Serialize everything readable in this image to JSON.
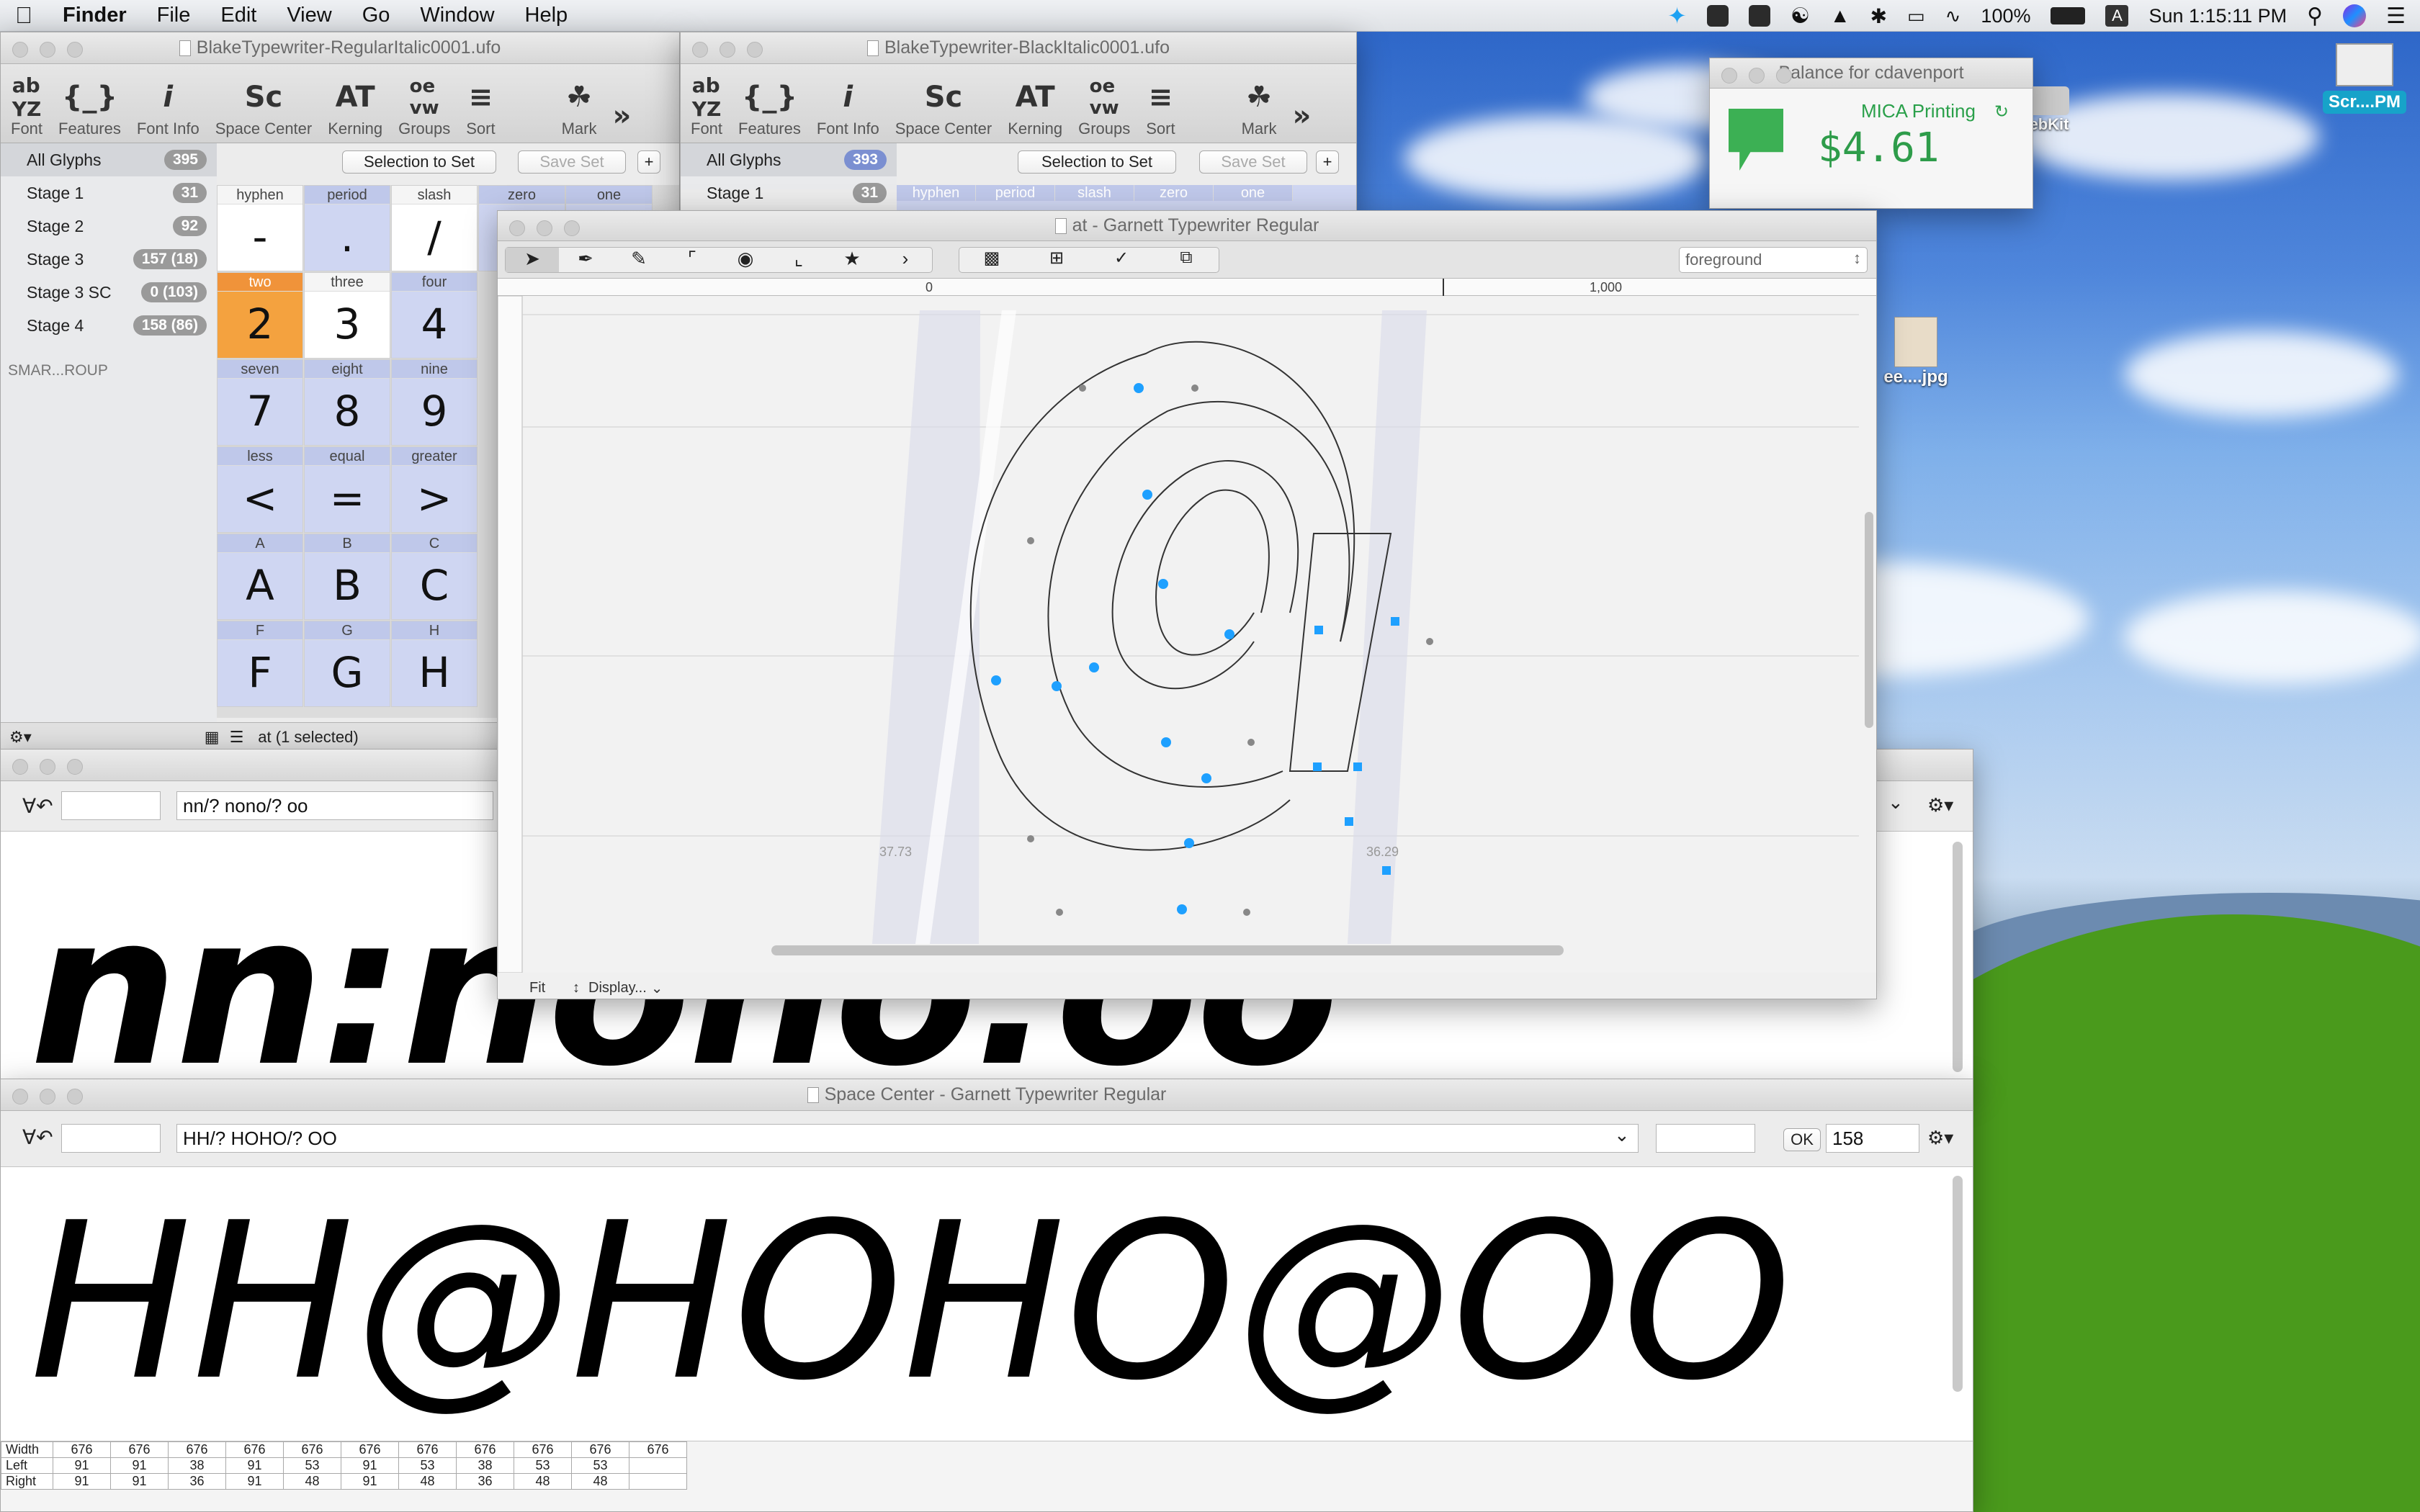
{
  "menubar": {
    "app": "Finder",
    "items": [
      "File",
      "Edit",
      "View",
      "Go",
      "Window",
      "Help"
    ],
    "battery": "100%",
    "clock": "Sun 1:15:11 PM"
  },
  "font_window_1": {
    "title": "BlakeTypewriter-RegularItalic0001.ufo",
    "toolbar": [
      "Font",
      "Features",
      "Font Info",
      "Space Center",
      "Kerning",
      "Groups",
      "Sort",
      "Mark"
    ],
    "sidebar": [
      {
        "label": "All Glyphs",
        "count": "395"
      },
      {
        "label": "Stage 1",
        "count": "31"
      },
      {
        "label": "Stage 2",
        "count": "92"
      },
      {
        "label": "Stage 3",
        "count": "157 (18)"
      },
      {
        "label": "Stage 3 SC",
        "count": "0 (103)"
      },
      {
        "label": "Stage 4",
        "count": "158 (86)"
      }
    ],
    "smart_group": "SMAR...ROUP",
    "selection_to_set": "Selection to Set",
    "save_set": "Save Set",
    "status": "at (1 selected)",
    "glyphs": [
      {
        "name": "hyphen",
        "char": "-"
      },
      {
        "name": "period",
        "char": "."
      },
      {
        "name": "slash",
        "char": "/"
      },
      {
        "name": "two",
        "char": "2"
      },
      {
        "name": "three",
        "char": "3"
      },
      {
        "name": "four",
        "char": "4"
      },
      {
        "name": "seven",
        "char": "7"
      },
      {
        "name": "eight",
        "char": "8"
      },
      {
        "name": "nine",
        "char": "9"
      },
      {
        "name": "less",
        "char": "<"
      },
      {
        "name": "equal",
        "char": "="
      },
      {
        "name": "greater",
        "char": ">"
      },
      {
        "name": "A",
        "char": "A"
      },
      {
        "name": "B",
        "char": "B"
      },
      {
        "name": "C",
        "char": "C"
      },
      {
        "name": "F",
        "char": "F"
      },
      {
        "name": "G",
        "char": "G"
      },
      {
        "name": "H",
        "char": "H"
      }
    ],
    "partial_cells": [
      "zero",
      "one"
    ]
  },
  "font_window_2": {
    "title": "BlakeTypewriter-BlackItalic0001.ufo",
    "toolbar": [
      "Font",
      "Features",
      "Font Info",
      "Space Center",
      "Kerning",
      "Groups",
      "Sort",
      "Mark"
    ],
    "sidebar": [
      {
        "label": "All Glyphs",
        "count": "393"
      },
      {
        "label": "Stage 1",
        "count": "31"
      }
    ],
    "selection_to_set": "Selection to Set",
    "save_set": "Save Set",
    "partial_cells": [
      "hyphen",
      "period",
      "slash",
      "zero",
      "one"
    ]
  },
  "balance_window": {
    "title": "Balance for cdavenport",
    "vendor": "MICA Printing",
    "amount": "$4.61"
  },
  "glyph_window": {
    "title": "at - Garnett Typewriter Regular",
    "layer": "foreground",
    "ruler": [
      "0",
      "1,000"
    ],
    "left_margin": "37.73",
    "right_margin": "36.29",
    "zoom": "Fit",
    "display": "Display..."
  },
  "space_center_1": {
    "text": "nn/? nono/? oo",
    "preview": "nn:nono:oo"
  },
  "space_center_2": {
    "title": "Space Center - Garnett Typewriter Regular",
    "text": "HH/? HOHO/? OO",
    "ok": "OK",
    "size": "158",
    "preview": "HH@HOHO@OO",
    "metrics": {
      "Width": [
        "676",
        "676",
        "676",
        "676",
        "676",
        "676",
        "676",
        "676",
        "676",
        "676",
        "676"
      ],
      "Left": [
        "91",
        "91",
        "38",
        "91",
        "53",
        "91",
        "53",
        "38",
        "53",
        "53",
        ""
      ],
      "Right": [
        "91",
        "91",
        "36",
        "91",
        "48",
        "91",
        "48",
        "36",
        "48",
        "48",
        ""
      ]
    }
  },
  "desktop": {
    "screenshot_label": "Scr....PM",
    "jpg_label": "ee....jpg",
    "webkit_label": "ebKit"
  }
}
